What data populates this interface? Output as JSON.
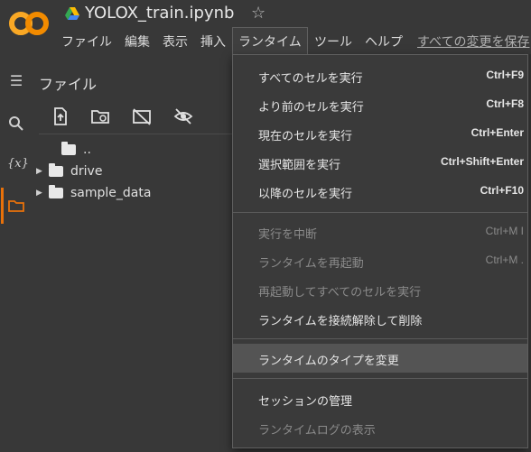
{
  "header": {
    "title": "YOLOX_train.ipynb",
    "logo_text": "CO",
    "menus": [
      "ファイル",
      "編集",
      "表示",
      "挿入",
      "ランタイム",
      "ツール",
      "ヘルプ"
    ],
    "save_link": "すべての変更を保存"
  },
  "sidebar": {
    "icons": [
      "table-of-contents-icon",
      "search-icon",
      "variables-icon",
      "folder-icon"
    ]
  },
  "files": {
    "title": "ファイル",
    "toolbar": [
      "upload-icon",
      "refresh-folder-icon",
      "hide-drive-icon",
      "hide-files-icon"
    ],
    "tree": [
      {
        "label": "..",
        "type": "parent"
      },
      {
        "label": "drive",
        "type": "folder"
      },
      {
        "label": "sample_data",
        "type": "folder"
      }
    ]
  },
  "runtime_menu": {
    "items": [
      {
        "label": "すべてのセルを実行",
        "shortcut": "Ctrl+F9",
        "disabled": false
      },
      {
        "label": "より前のセルを実行",
        "shortcut": "Ctrl+F8",
        "disabled": false
      },
      {
        "label": "現在のセルを実行",
        "shortcut": "Ctrl+Enter",
        "disabled": false
      },
      {
        "label": "選択範囲を実行",
        "shortcut": "Ctrl+Shift+Enter",
        "disabled": false
      },
      {
        "label": "以降のセルを実行",
        "shortcut": "Ctrl+F10",
        "disabled": false
      },
      {
        "label": "実行を中断",
        "shortcut": "Ctrl+M I",
        "disabled": true
      },
      {
        "label": "ランタイムを再起動",
        "shortcut": "Ctrl+M .",
        "disabled": true
      },
      {
        "label": "再起動してすべてのセルを実行",
        "shortcut": "",
        "disabled": true
      },
      {
        "label": "ランタイムを接続解除して削除",
        "shortcut": "",
        "disabled": false
      },
      {
        "label": "ランタイムのタイプを変更",
        "shortcut": "",
        "disabled": false,
        "highlighted": true
      },
      {
        "label": "セッションの管理",
        "shortcut": "",
        "disabled": false
      },
      {
        "label": "ランタイムログの表示",
        "shortcut": "",
        "disabled": true
      }
    ]
  },
  "colors": {
    "logo_orange": "#f9a825",
    "accent": "#e8710a",
    "background": "#383838"
  }
}
